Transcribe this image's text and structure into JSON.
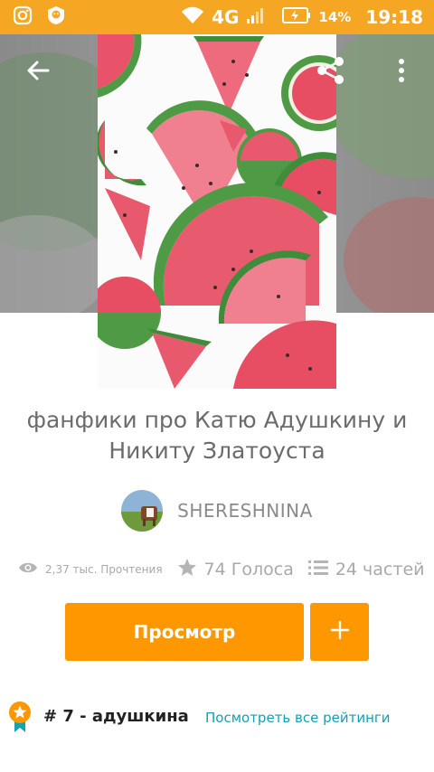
{
  "status_bar": {
    "network": "4G",
    "battery": "14%",
    "time": "19:18"
  },
  "story": {
    "title_line1": "фанфики про Катю Адушкину и",
    "title_line2": "Никиту Златоуста",
    "author": "SHERESHNINA"
  },
  "stats": {
    "reads": "2,37 тыс. Прочтения",
    "votes": "74 Голоса",
    "parts": "24 частей"
  },
  "actions": {
    "read_label": "Просмотр",
    "add_label": "+"
  },
  "ranking": {
    "rank_text": "# 7 - адушкина",
    "view_all": "Посмотреть все рейтинги"
  },
  "icons": [
    "instagram-icon",
    "app-badge-icon",
    "wifi-icon",
    "signal-icon",
    "battery-icon",
    "back-arrow-icon",
    "share-icon",
    "more-vert-icon",
    "eye-icon",
    "star-icon",
    "list-icon",
    "plus-icon",
    "rank-badge-icon"
  ],
  "colors": {
    "accent": "#ff9800",
    "status_bar": "#f5a623",
    "link": "#14a0b4",
    "muted_text": "#a9a9a9"
  }
}
